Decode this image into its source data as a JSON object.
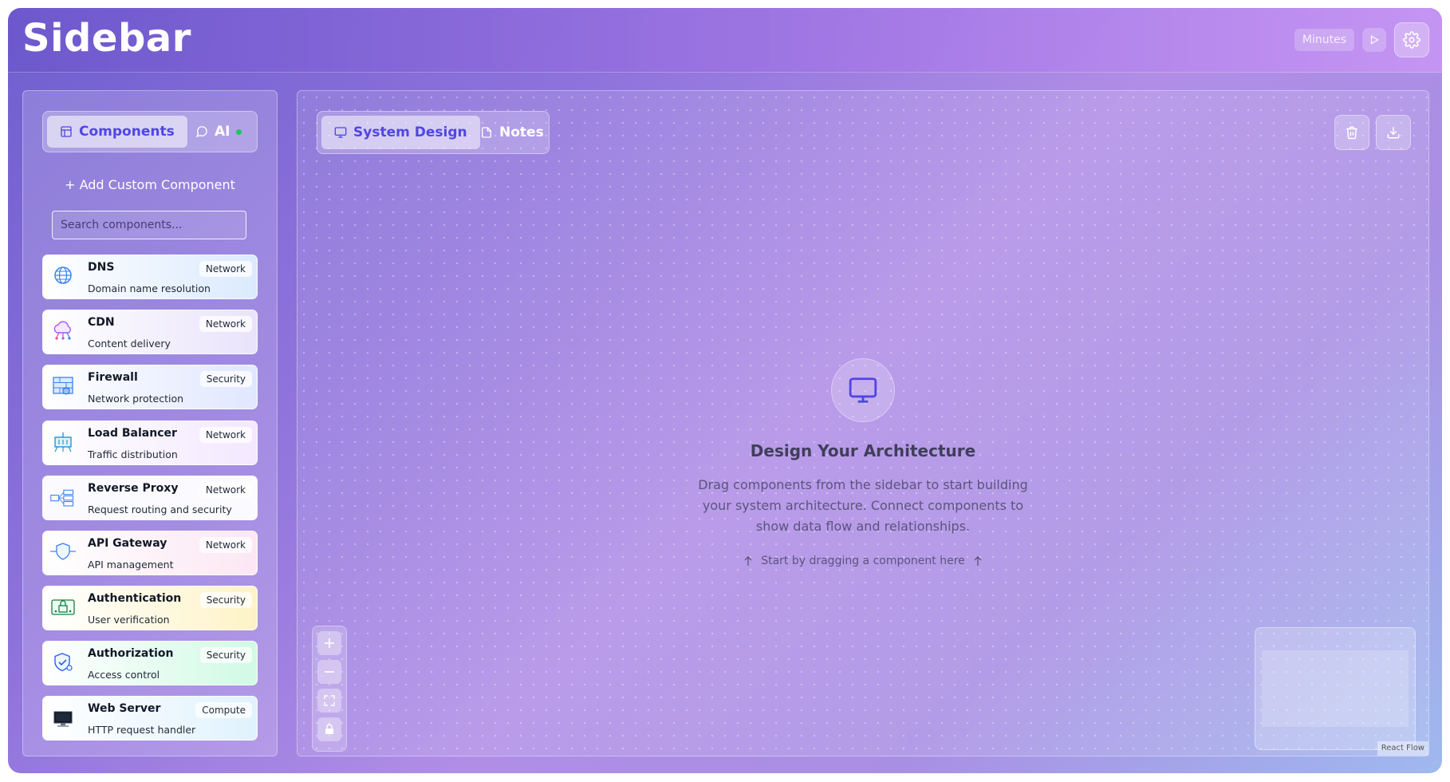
{
  "app": {
    "title": "Sidebar"
  },
  "top_actions": {
    "timer_label": "Minutes"
  },
  "sidebar": {
    "tabs": [
      {
        "label": "Components",
        "active": true
      },
      {
        "label": "AI",
        "status_color": "#22c55e"
      }
    ],
    "add_custom_label": "+ Add Custom Component",
    "search": {
      "placeholder": "Search components...",
      "value": ""
    },
    "components": [
      {
        "name": "DNS",
        "description": "Domain name resolution",
        "category": "Network",
        "icon": "globe-icon",
        "bg": "#dbeafe"
      },
      {
        "name": "CDN",
        "description": "Content delivery",
        "category": "Network",
        "icon": "cloud-network-icon",
        "bg": "#ede9fe"
      },
      {
        "name": "Firewall",
        "description": "Network protection",
        "category": "Security",
        "icon": "firewall-icon",
        "bg": "#e0e7ff"
      },
      {
        "name": "Load Balancer",
        "description": "Traffic distribution",
        "category": "Network",
        "icon": "load-balancer-icon",
        "bg": "#f3e8ff"
      },
      {
        "name": "Reverse Proxy",
        "description": "Request routing and security",
        "category": "Network",
        "icon": "reverse-proxy-icon",
        "bg": "#ffffff"
      },
      {
        "name": "API Gateway",
        "description": "API management",
        "category": "Network",
        "icon": "shield-gateway-icon",
        "bg": "#fce7f3"
      },
      {
        "name": "Authentication",
        "description": "User verification",
        "category": "Security",
        "icon": "lock-icon",
        "bg": "#fef3c7"
      },
      {
        "name": "Authorization",
        "description": "Access control",
        "category": "Security",
        "icon": "shield-check-icon",
        "bg": "#d1fae5"
      },
      {
        "name": "Web Server",
        "description": "HTTP request handler",
        "category": "Compute",
        "icon": "monitor-icon",
        "bg": "#e0f2fe"
      }
    ]
  },
  "canvas": {
    "tabs": [
      {
        "label": "System Design",
        "active": true
      },
      {
        "label": "Notes"
      }
    ],
    "empty_state": {
      "title": "Design Your Architecture",
      "text": "Drag components from the sidebar to start building your system architecture. Connect components to show data flow and relationships.",
      "hint": "Start by dragging a component here"
    },
    "attribution": "React Flow"
  },
  "colors": {
    "accent": "#4f46e5",
    "online": "#22c55e"
  }
}
